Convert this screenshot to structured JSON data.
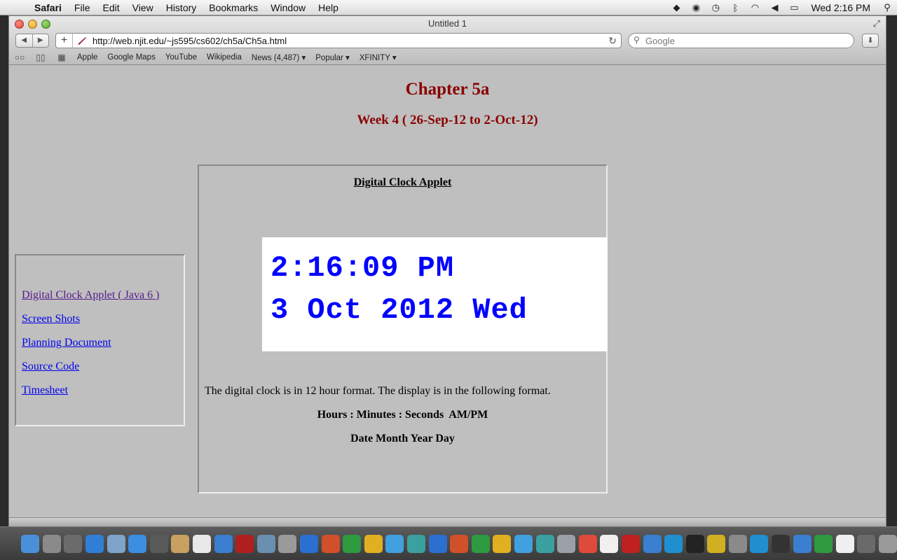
{
  "menubar": {
    "app_name": "Safari",
    "items": [
      "File",
      "Edit",
      "View",
      "History",
      "Bookmarks",
      "Window",
      "Help"
    ],
    "clock": "Wed 2:16 PM",
    "status_icons": [
      "dropbox-icon",
      "skype-icon",
      "time-machine-icon",
      "bluetooth-icon",
      "wifi-icon",
      "volume-icon",
      "battery-icon",
      "spotlight-icon"
    ]
  },
  "window": {
    "title": "Untitled 1",
    "url": "http://web.njit.edu/~js595/cs602/ch5a/Ch5a.html",
    "search_placeholder": "Google"
  },
  "bookmarks": [
    "Apple",
    "Google Maps",
    "YouTube",
    "Wikipedia",
    "News (4,487) ▾",
    "Popular ▾",
    "XFINITY ▾"
  ],
  "page": {
    "title": "Chapter 5a",
    "week": "Week 4 ( 26-Sep-12 to 2-Oct-12)",
    "nav_links": [
      "Digital Clock Applet ( Java 6 )",
      "Screen Shots",
      "Planning Document",
      "Source Code",
      "Timesheet"
    ],
    "applet_heading": "Digital Clock Applet",
    "clock_time": "2:16:09 PM",
    "clock_date": "3 Oct 2012 Wed",
    "description": "The digital clock is in 12 hour format. The display is in the following format.",
    "format_line1": "Hours : Minutes : Seconds  AM/PM",
    "format_line2": "Date Month Year Day"
  },
  "colors": {
    "heading": "#8b0000",
    "clock_text": "#0000ff",
    "link": "#0000ee",
    "visited_link": "#551a8b",
    "page_background": "#bfbfbf"
  },
  "dock": {
    "app_icons": [
      "finder-icon",
      "launchpad-icon",
      "mission-control-icon",
      "app-store-icon",
      "preview-icon",
      "safari-icon",
      "facetime-icon",
      "contacts-icon",
      "calendar-icon",
      "itunes-icon",
      "photo-booth-icon",
      "iphoto-icon",
      "image-capture-icon",
      "word-icon",
      "powerpoint-icon",
      "excel-icon",
      "outlook-icon",
      "messenger-icon",
      "sharepoint-icon",
      "word-icon-2",
      "powerpoint-icon-2",
      "excel-icon-2",
      "outlook-icon-2",
      "messenger-icon-2",
      "sharepoint-icon-2",
      "utility-icon",
      "chrome-icon",
      "textedit-icon",
      "acrobat-icon",
      "speed-test-icon",
      "quicktime-icon",
      "terminal-icon",
      "vpn-icon",
      "system-utility-icon",
      "quicktime-icon-2",
      "activity-monitor-icon",
      "network-icon",
      "spotify-icon",
      "document-icon",
      "photos-folder-icon",
      "trash-icon"
    ],
    "app_colors": [
      "#4a90d9",
      "#8a8a8a",
      "#6b6b6b",
      "#2f7fd8",
      "#7fa3c9",
      "#3b8ee0",
      "#5a5a5a",
      "#c8a060",
      "#e8e8e8",
      "#3a7fd0",
      "#b02020",
      "#6a8fb0",
      "#9a9a9a",
      "#2b6fd0",
      "#d0502a",
      "#2e9a40",
      "#e0b020",
      "#40a0e0",
      "#3aa0a0",
      "#2b6fd0",
      "#d0502a",
      "#2e9a40",
      "#e0b020",
      "#40a0e0",
      "#3aa0a0",
      "#9aa0a8",
      "#e04a3a",
      "#f0f0f0",
      "#c02020",
      "#3a7fd0",
      "#1f8fd0",
      "#222222",
      "#d0b020",
      "#8a8a8a",
      "#1f8fd0",
      "#333333",
      "#3a7fd0",
      "#2e9a40",
      "#f0f0f0",
      "#6a6a6a",
      "#9a9a9a"
    ]
  }
}
